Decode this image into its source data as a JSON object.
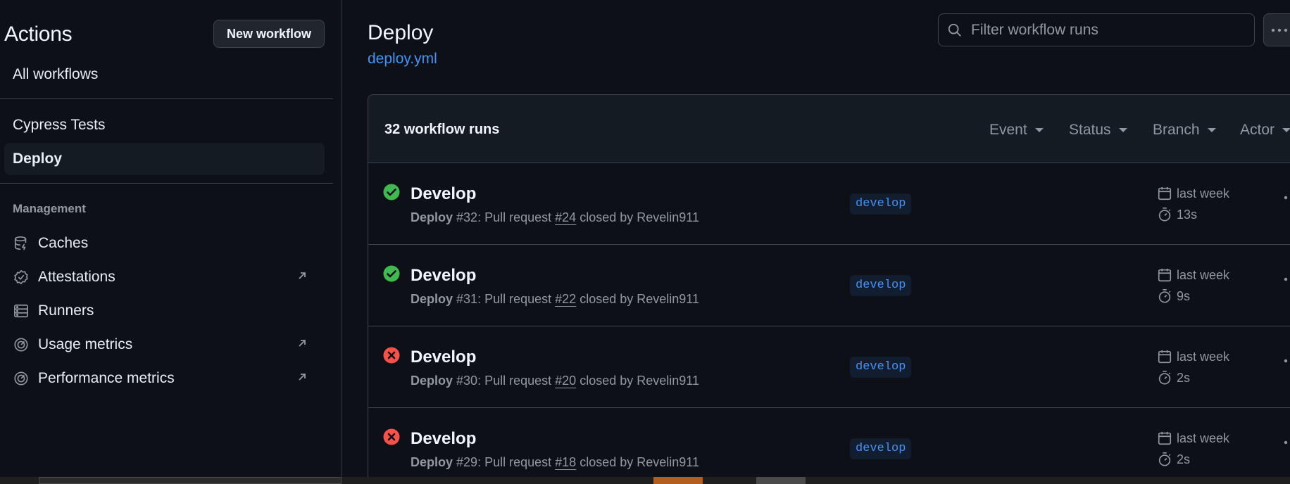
{
  "sidebar": {
    "title": "Actions",
    "new_workflow_label": "New workflow",
    "all_workflows_label": "All workflows",
    "workflows": [
      {
        "label": "Cypress Tests",
        "active": false
      },
      {
        "label": "Deploy",
        "active": true
      }
    ],
    "management_label": "Management",
    "management_items": [
      {
        "label": "Caches",
        "icon": "database-icon",
        "external": false
      },
      {
        "label": "Attestations",
        "icon": "verified-icon",
        "external": true
      },
      {
        "label": "Runners",
        "icon": "server-icon",
        "external": false
      },
      {
        "label": "Usage metrics",
        "icon": "meter-icon",
        "external": true
      },
      {
        "label": "Performance metrics",
        "icon": "meter-icon",
        "external": true
      }
    ]
  },
  "main": {
    "title": "Deploy",
    "workflow_file": "deploy.yml",
    "filter_placeholder": "Filter workflow runs",
    "runs_count_label": "32 workflow runs",
    "filters": [
      "Event",
      "Status",
      "Branch",
      "Actor"
    ],
    "runs": [
      {
        "status": "success",
        "title": "Develop",
        "workflow": "Deploy",
        "number": "#32",
        "event_text": ": Pull request ",
        "pr": "#24",
        "closed_text": " closed by Revelin911",
        "branch": "develop",
        "when": "last week",
        "duration": "13s"
      },
      {
        "status": "success",
        "title": "Develop",
        "workflow": "Deploy",
        "number": "#31",
        "event_text": ": Pull request ",
        "pr": "#22",
        "closed_text": " closed by Revelin911",
        "branch": "develop",
        "when": "last week",
        "duration": "9s"
      },
      {
        "status": "failure",
        "title": "Develop",
        "workflow": "Deploy",
        "number": "#30",
        "event_text": ": Pull request ",
        "pr": "#20",
        "closed_text": " closed by Revelin911",
        "branch": "develop",
        "when": "last week",
        "duration": "2s"
      },
      {
        "status": "failure",
        "title": "Develop",
        "workflow": "Deploy",
        "number": "#29",
        "event_text": ": Pull request ",
        "pr": "#18",
        "closed_text": " closed by Revelin911",
        "branch": "develop",
        "when": "last week",
        "duration": "2s"
      }
    ]
  },
  "colors": {
    "background": "#0d1117",
    "success": "#3fb950",
    "failure": "#f85149",
    "link": "#4493f8",
    "muted": "#9198a1"
  }
}
